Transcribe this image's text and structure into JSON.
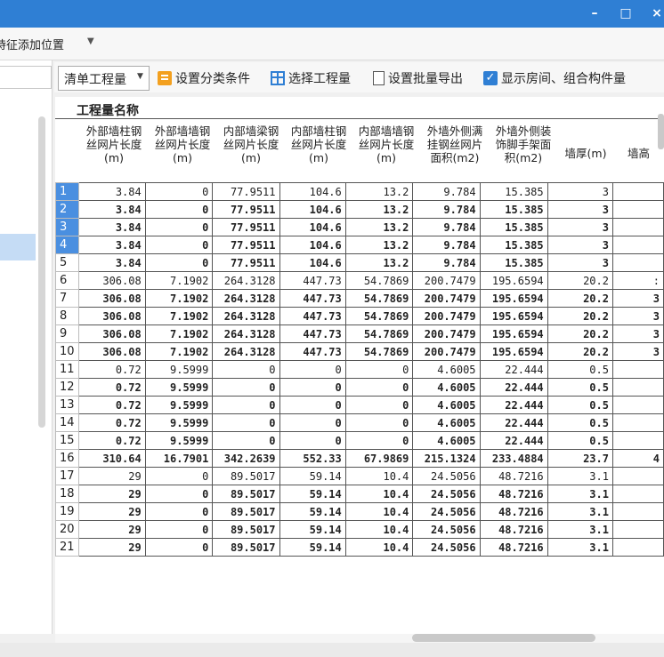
{
  "window": {
    "minimize": "–",
    "maximize": "□",
    "close": "×"
  },
  "topbar": {
    "label": "持征添加位置"
  },
  "toolbar": {
    "select_value": "清单工程量",
    "set_class": "设置分类条件",
    "select_qty": "选择工程量",
    "set_export": "设置批量导出",
    "show_rooms": "显示房间、组合构件量"
  },
  "table": {
    "group_title": "工程量名称",
    "columns": [
      "外部墙柱钢丝网片长度(m)",
      "外部墙墙钢丝网片长度(m)",
      "内部墙梁钢丝网片长度(m)",
      "内部墙柱钢丝网片长度(m)",
      "内部墙墙钢丝网片长度(m)",
      "外墙外侧满挂钢丝网片面积(m2)",
      "外墙外侧装饰脚手架面积(m2)",
      "墙厚(m)",
      "墙高"
    ],
    "rows": [
      {
        "n": "1",
        "bold": false,
        "v": [
          "3.84",
          "0",
          "77.9511",
          "104.6",
          "13.2",
          "9.784",
          "15.385",
          "3",
          ""
        ]
      },
      {
        "n": "2",
        "bold": true,
        "v": [
          "3.84",
          "0",
          "77.9511",
          "104.6",
          "13.2",
          "9.784",
          "15.385",
          "3",
          ""
        ]
      },
      {
        "n": "3",
        "bold": true,
        "v": [
          "3.84",
          "0",
          "77.9511",
          "104.6",
          "13.2",
          "9.784",
          "15.385",
          "3",
          ""
        ]
      },
      {
        "n": "4",
        "bold": true,
        "v": [
          "3.84",
          "0",
          "77.9511",
          "104.6",
          "13.2",
          "9.784",
          "15.385",
          "3",
          ""
        ]
      },
      {
        "n": "5",
        "bold": true,
        "v": [
          "3.84",
          "0",
          "77.9511",
          "104.6",
          "13.2",
          "9.784",
          "15.385",
          "3",
          ""
        ]
      },
      {
        "n": "6",
        "bold": false,
        "v": [
          "306.08",
          "7.1902",
          "264.3128",
          "447.73",
          "54.7869",
          "200.7479",
          "195.6594",
          "20.2",
          ":"
        ]
      },
      {
        "n": "7",
        "bold": true,
        "v": [
          "306.08",
          "7.1902",
          "264.3128",
          "447.73",
          "54.7869",
          "200.7479",
          "195.6594",
          "20.2",
          "3"
        ]
      },
      {
        "n": "8",
        "bold": true,
        "v": [
          "306.08",
          "7.1902",
          "264.3128",
          "447.73",
          "54.7869",
          "200.7479",
          "195.6594",
          "20.2",
          "3"
        ]
      },
      {
        "n": "9",
        "bold": true,
        "v": [
          "306.08",
          "7.1902",
          "264.3128",
          "447.73",
          "54.7869",
          "200.7479",
          "195.6594",
          "20.2",
          "3"
        ]
      },
      {
        "n": "10",
        "bold": true,
        "v": [
          "306.08",
          "7.1902",
          "264.3128",
          "447.73",
          "54.7869",
          "200.7479",
          "195.6594",
          "20.2",
          "3"
        ]
      },
      {
        "n": "11",
        "bold": false,
        "v": [
          "0.72",
          "9.5999",
          "0",
          "0",
          "0",
          "4.6005",
          "22.444",
          "0.5",
          ""
        ]
      },
      {
        "n": "12",
        "bold": true,
        "v": [
          "0.72",
          "9.5999",
          "0",
          "0",
          "0",
          "4.6005",
          "22.444",
          "0.5",
          ""
        ]
      },
      {
        "n": "13",
        "bold": true,
        "v": [
          "0.72",
          "9.5999",
          "0",
          "0",
          "0",
          "4.6005",
          "22.444",
          "0.5",
          ""
        ]
      },
      {
        "n": "14",
        "bold": true,
        "v": [
          "0.72",
          "9.5999",
          "0",
          "0",
          "0",
          "4.6005",
          "22.444",
          "0.5",
          ""
        ]
      },
      {
        "n": "15",
        "bold": true,
        "v": [
          "0.72",
          "9.5999",
          "0",
          "0",
          "0",
          "4.6005",
          "22.444",
          "0.5",
          ""
        ]
      },
      {
        "n": "16",
        "bold": true,
        "v": [
          "310.64",
          "16.7901",
          "342.2639",
          "552.33",
          "67.9869",
          "215.1324",
          "233.4884",
          "23.7",
          "4"
        ]
      },
      {
        "n": "17",
        "bold": false,
        "v": [
          "29",
          "0",
          "89.5017",
          "59.14",
          "10.4",
          "24.5056",
          "48.7216",
          "3.1",
          ""
        ]
      },
      {
        "n": "18",
        "bold": true,
        "v": [
          "29",
          "0",
          "89.5017",
          "59.14",
          "10.4",
          "24.5056",
          "48.7216",
          "3.1",
          ""
        ]
      },
      {
        "n": "19",
        "bold": true,
        "v": [
          "29",
          "0",
          "89.5017",
          "59.14",
          "10.4",
          "24.5056",
          "48.7216",
          "3.1",
          ""
        ]
      },
      {
        "n": "20",
        "bold": true,
        "v": [
          "29",
          "0",
          "89.5017",
          "59.14",
          "10.4",
          "24.5056",
          "48.7216",
          "3.1",
          ""
        ]
      },
      {
        "n": "21",
        "bold": true,
        "v": [
          "29",
          "0",
          "89.5017",
          "59.14",
          "10.4",
          "24.5056",
          "48.7216",
          "3.1",
          ""
        ]
      }
    ],
    "selected_rows": [
      "1",
      "2",
      "3",
      "4"
    ]
  }
}
